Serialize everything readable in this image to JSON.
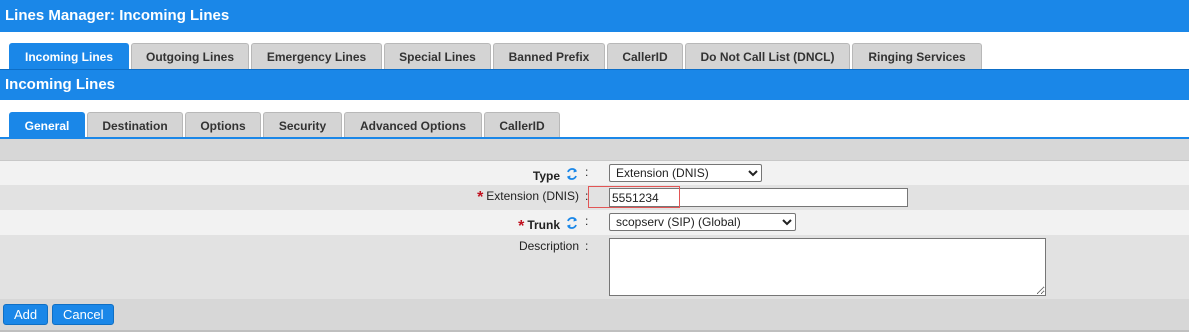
{
  "window": {
    "title": "Lines Manager:  Incoming Lines"
  },
  "main_tabs": [
    {
      "label": "Incoming Lines",
      "active": true
    },
    {
      "label": "Outgoing Lines",
      "active": false
    },
    {
      "label": "Emergency Lines",
      "active": false
    },
    {
      "label": "Special Lines",
      "active": false
    },
    {
      "label": "Banned Prefix",
      "active": false
    },
    {
      "label": "CallerID",
      "active": false
    },
    {
      "label": "Do Not Call List (DNCL)",
      "active": false
    },
    {
      "label": "Ringing Services",
      "active": false
    }
  ],
  "section": {
    "title": "Incoming Lines"
  },
  "sub_tabs": [
    {
      "label": "General",
      "active": true
    },
    {
      "label": "Destination",
      "active": false
    },
    {
      "label": "Options",
      "active": false
    },
    {
      "label": "Security",
      "active": false
    },
    {
      "label": "Advanced Options",
      "active": false
    },
    {
      "label": "CallerID",
      "active": false
    }
  ],
  "form": {
    "colon": ":",
    "required_mark": "*",
    "type": {
      "label": "Type",
      "value": "Extension (DNIS)",
      "icon": "refresh-icon"
    },
    "extension": {
      "label": "Extension (DNIS)",
      "value": "5551234",
      "required": true
    },
    "trunk": {
      "label": "Trunk",
      "value": "scopserv (SIP) (Global)",
      "required": true,
      "icon": "refresh-icon"
    },
    "description": {
      "label": "Description",
      "value": ""
    }
  },
  "buttons": {
    "add": "Add",
    "cancel": "Cancel"
  },
  "colors": {
    "accent": "#1a87e8",
    "tab_bg": "#d4d4d4",
    "required": "#c0111f",
    "highlight": "#e25555"
  }
}
